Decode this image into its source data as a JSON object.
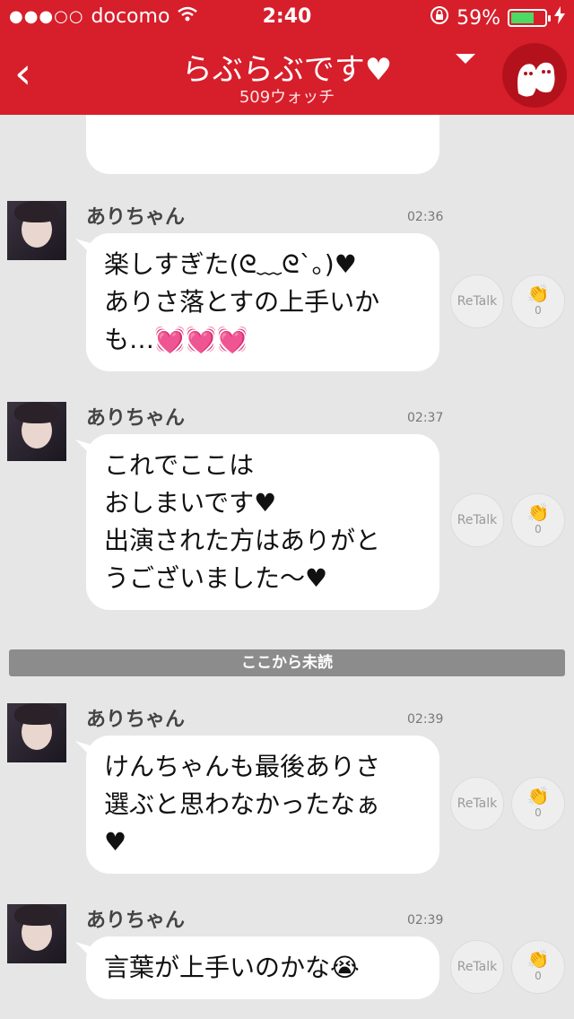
{
  "status": {
    "signal": "●●●○○",
    "carrier": "docomo",
    "time": "2:40",
    "battery": "59%"
  },
  "header": {
    "back": "‹",
    "title": "らぶらぶです♥",
    "subtitle": "509ウォッチ"
  },
  "unread_label": "ここから未読",
  "messages": [
    {
      "name": "ありちゃん",
      "time": "02:36",
      "lines": [
        "楽しすぎた(ᘓ﹏ᘓ`｡)♥",
        "ありさ落とすの上手いか",
        "も…💓💓💓"
      ],
      "retalk": "ReTalk",
      "claps": "0"
    },
    {
      "name": "ありちゃん",
      "time": "02:37",
      "lines": [
        "これでここは",
        "おしまいです♥",
        "出演された方はありがと",
        "うございました〜♥"
      ],
      "retalk": "ReTalk",
      "claps": "0"
    },
    {
      "name": "ありちゃん",
      "time": "02:39",
      "lines": [
        "けんちゃんも最後ありさ",
        "選ぶと思わなかったなぁ",
        "♥"
      ],
      "retalk": "ReTalk",
      "claps": "0"
    },
    {
      "name": "ありちゃん",
      "time": "02:39",
      "lines": [
        "言葉が上手いのかな😭"
      ],
      "retalk": "ReTalk",
      "claps": "0"
    }
  ]
}
